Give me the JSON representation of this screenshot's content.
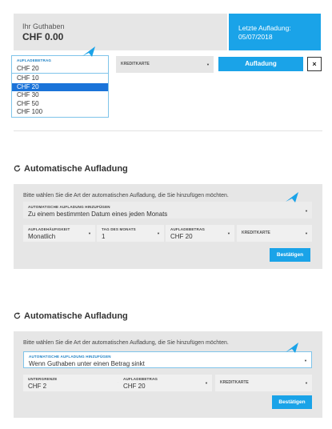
{
  "balance": {
    "label": "Ihr Guthaben",
    "value": "CHF 0.00"
  },
  "last_topup": {
    "label": "Letzte Aufladung:",
    "date": "05/07/2018"
  },
  "topup_form": {
    "amount_label": "AUFLADEBETRAG",
    "amount_value": "CHF 20",
    "amount_options": [
      "CHF 10",
      "CHF 20",
      "CHF 30",
      "CHF 50",
      "CHF 100"
    ],
    "amount_selected_index": 1,
    "card_placeholder": "KREDITKARTE",
    "submit_label": "Aufladung",
    "close_label": "×"
  },
  "section1": {
    "title": "Automatische Aufladung",
    "intro": "Bitte wählen Sie die Art der automatischen Aufladung, die Sie hinzufügen möchten.",
    "type_label": "AUTOMATISCHE AUFLADUNG HINZUFÜGEN",
    "type_value": "Zu einem bestimmten Datum eines jeden Monats",
    "frequency_label": "AUFLADEHÄUFIGKEIT",
    "frequency_value": "Monatlich",
    "day_label": "TAG DES MONATS",
    "day_value": "1",
    "amount_label": "AUFLADEBETRAG",
    "amount_value": "CHF 20",
    "card_placeholder": "KREDITKARTE",
    "confirm_label": "Bestätigen"
  },
  "section2": {
    "title": "Automatische Aufladung",
    "intro": "Bitte wählen Sie die Art der automatischen Aufladung, die Sie hinzufügen möchten.",
    "type_label": "AUTOMATISCHE AUFLADUNG HINZUFÜGEN",
    "type_value": "Wenn Guthaben unter einen Betrag sinkt",
    "lower_label": "UNTERGRENZE",
    "lower_value": "CHF 2",
    "amount_label": "AUFLADEBETRAG",
    "amount_value": "CHF 20",
    "card_placeholder": "KREDITKARTE",
    "confirm_label": "Bestätigen"
  },
  "colors": {
    "accent": "#1aa3e8",
    "selected": "#1a73d9",
    "panel": "#e6e6e6",
    "focus_border": "#7fc4ea"
  },
  "icons": {
    "refresh": "refresh-icon",
    "caret": "caret-down-icon",
    "close": "close-icon",
    "pointer": "cursor-arrow-icon"
  }
}
